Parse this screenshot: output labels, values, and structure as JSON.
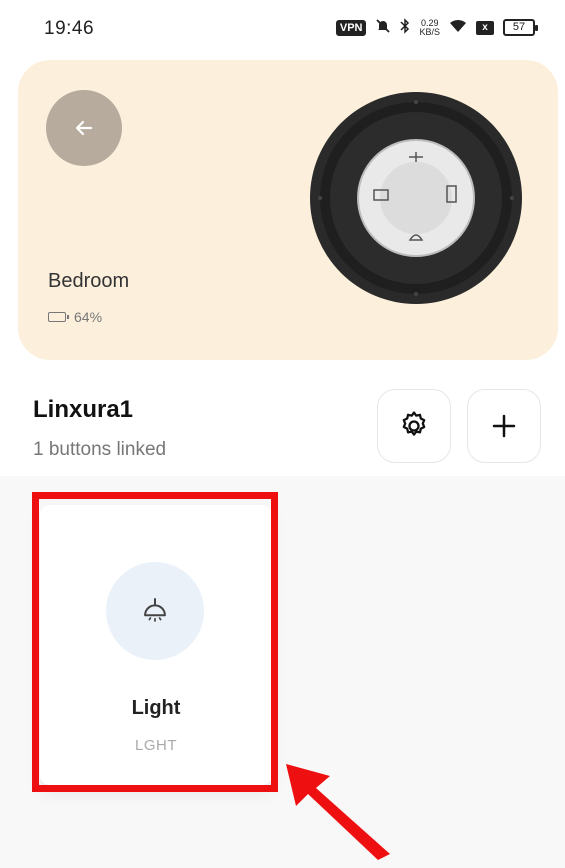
{
  "status_bar": {
    "time": "19:46",
    "vpn_label": "VPN",
    "speed_value": "0.29",
    "speed_unit": "KB/S",
    "sim_label": "x",
    "battery_level": "57",
    "icons": [
      "vpn-icon",
      "bell-off-icon",
      "bluetooth-icon",
      "network-speed-icon",
      "wifi-icon",
      "sim-off-icon",
      "battery-icon"
    ]
  },
  "hero": {
    "room_name": "Bedroom",
    "battery_percent": "64%",
    "background_color": "#fcf0dd",
    "back_icon": "arrow-left-icon"
  },
  "device": {
    "name": "Linxura1",
    "linked_count_text": "1 buttons linked",
    "settings_icon": "gear-icon",
    "add_icon": "plus-icon"
  },
  "buttons": [
    {
      "name": "Light",
      "code": "LGHT",
      "icon": "ceiling-lamp-icon",
      "icon_bg": "#eaf1f9"
    }
  ],
  "annotation": {
    "highlight_color": "#ee1010",
    "arrow_color": "#ee1010"
  }
}
